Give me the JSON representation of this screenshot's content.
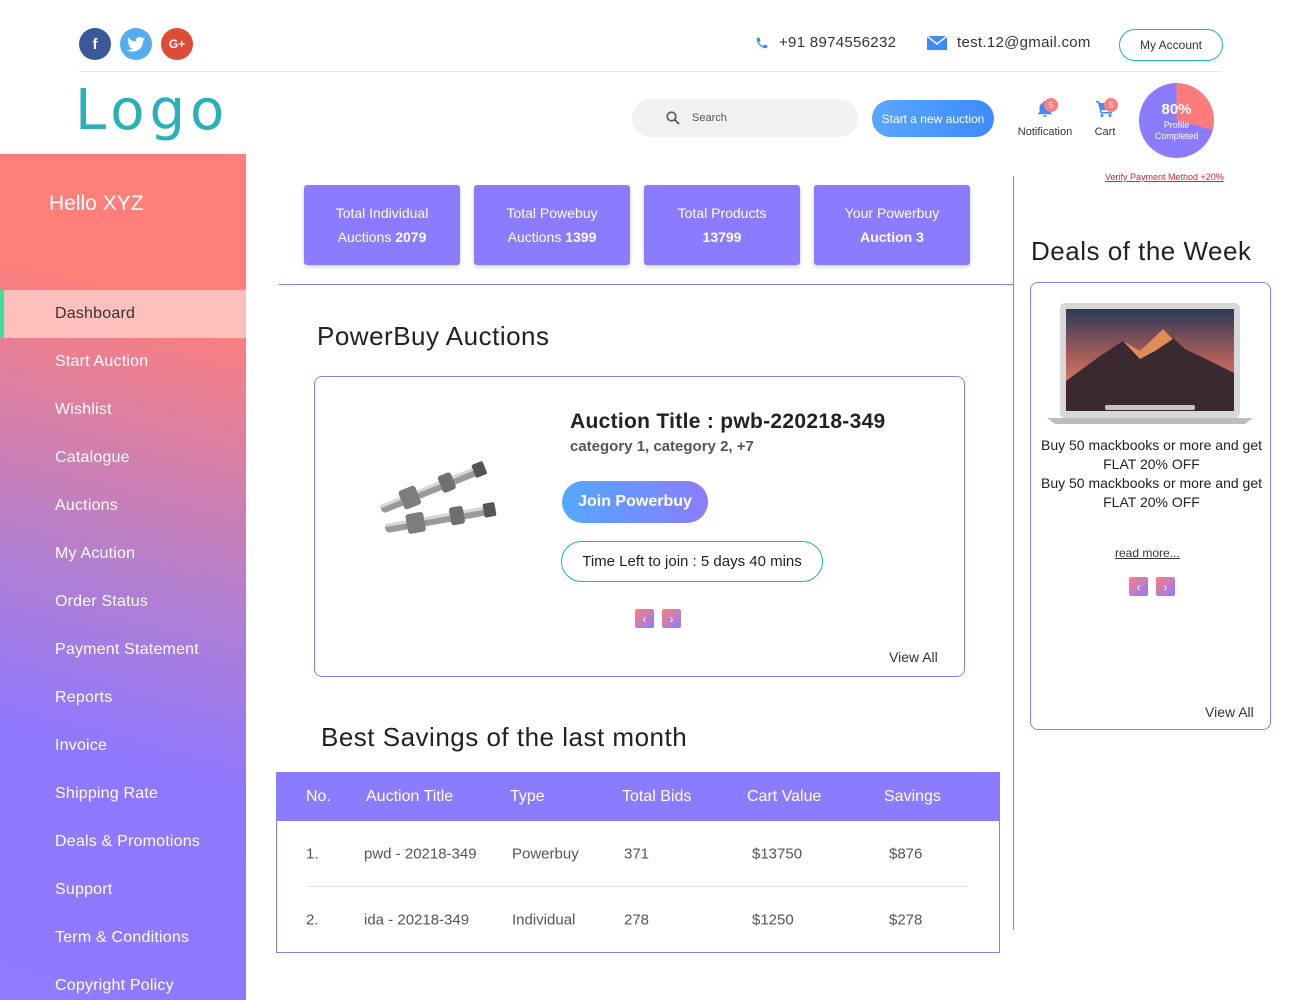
{
  "social": [
    "facebook-icon",
    "twitter-icon",
    "google-plus-icon"
  ],
  "contact": {
    "phone": "+91 8974556232",
    "email": "test.12@gmail.com"
  },
  "header": {
    "my_account": "My Account",
    "logo": "Logo",
    "search_placeholder": "Search",
    "start_auction": "Start a new auction",
    "notification_label": "Notification",
    "notification_count": "5",
    "cart_label": "Cart",
    "cart_count": "5",
    "profile_percent": "80%",
    "profile_label_1": "Profile",
    "profile_label_2": "Completed",
    "profile_fraction": 0.8,
    "verify_link": "Verify Payment Method +20%"
  },
  "sidebar": {
    "greeting": "Hello XYZ",
    "items": [
      {
        "label": "Dashboard",
        "active": true
      },
      {
        "label": "Start Auction"
      },
      {
        "label": "Wishlist"
      },
      {
        "label": "Catalogue"
      },
      {
        "label": "Auctions"
      },
      {
        "label": "My Acution"
      },
      {
        "label": "Order Status"
      },
      {
        "label": "Payment Statement"
      },
      {
        "label": "Reports"
      },
      {
        "label": "Invoice"
      },
      {
        "label": "Shipping Rate"
      },
      {
        "label": "Deals & Promotions"
      },
      {
        "label": "Support"
      },
      {
        "label": "Term & Conditions"
      },
      {
        "label": "Copyright Policy"
      }
    ]
  },
  "stats": [
    {
      "line1": "Total Individual",
      "line2_text": "Auctions ",
      "line2_value": "2079"
    },
    {
      "line1": "Total Powebuy",
      "line2_text": "Auctions ",
      "line2_value": "1399"
    },
    {
      "line1": "Total Products",
      "line2_text": "",
      "line2_value": "13799"
    },
    {
      "line1": "Your Powerbuy",
      "line2_text": "",
      "line2_value": "Auction 3"
    }
  ],
  "powerbuy": {
    "title": "PowerBuy Auctions",
    "auction_title": "Auction Title  : pwb-220218-349",
    "categories": "category 1, category 2, +7",
    "join_label": "Join Powerbuy",
    "time_left": "Time Left to join : 5 days 40 mins",
    "view_all": "View All"
  },
  "savings": {
    "title": "Best Savings of the last month",
    "columns": [
      "No.",
      "Auction Title",
      "Type",
      "Total Bids",
      "Cart Value",
      "Savings"
    ],
    "rows": [
      [
        "1.",
        "pwd - 20218-349",
        "Powerbuy",
        "371",
        "$13750",
        "$876"
      ],
      [
        "2.",
        "ida - 20218-349",
        "Individual",
        "278",
        "$1250",
        "$278"
      ]
    ]
  },
  "deals": {
    "title": "Deals of the Week",
    "text_1": "Buy 50 mackbooks or more and get FLAT 20% OFF",
    "text_2": "Buy 50 mackbooks or more and get FLAT 20% OFF",
    "read_more": "read  more...",
    "view_all": "View All"
  },
  "colors": {
    "accent": "#8b7cff",
    "coral": "#ff7f7a",
    "teal": "#2ab0b8",
    "blue": "#3d8bff"
  }
}
